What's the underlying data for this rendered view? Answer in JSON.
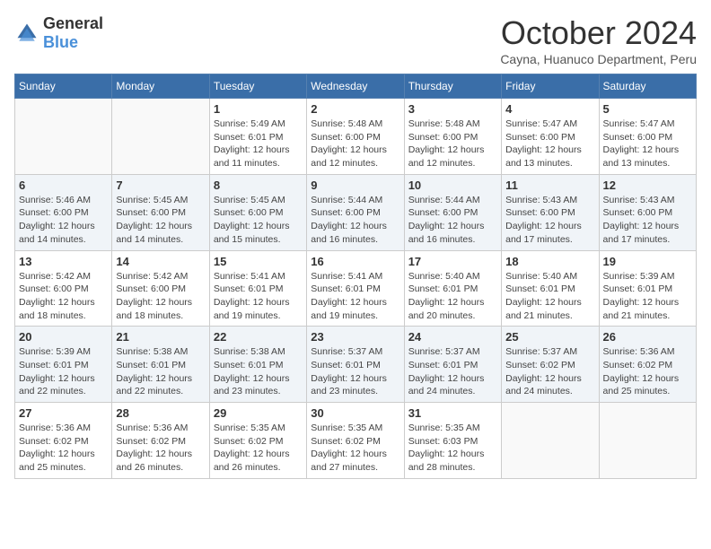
{
  "header": {
    "logo_general": "General",
    "logo_blue": "Blue",
    "month": "October 2024",
    "location": "Cayna, Huanuco Department, Peru"
  },
  "weekdays": [
    "Sunday",
    "Monday",
    "Tuesday",
    "Wednesday",
    "Thursday",
    "Friday",
    "Saturday"
  ],
  "weeks": [
    [
      {
        "day": "",
        "sunrise": "",
        "sunset": "",
        "daylight": ""
      },
      {
        "day": "",
        "sunrise": "",
        "sunset": "",
        "daylight": ""
      },
      {
        "day": "1",
        "sunrise": "Sunrise: 5:49 AM",
        "sunset": "Sunset: 6:01 PM",
        "daylight": "Daylight: 12 hours and 11 minutes."
      },
      {
        "day": "2",
        "sunrise": "Sunrise: 5:48 AM",
        "sunset": "Sunset: 6:00 PM",
        "daylight": "Daylight: 12 hours and 12 minutes."
      },
      {
        "day": "3",
        "sunrise": "Sunrise: 5:48 AM",
        "sunset": "Sunset: 6:00 PM",
        "daylight": "Daylight: 12 hours and 12 minutes."
      },
      {
        "day": "4",
        "sunrise": "Sunrise: 5:47 AM",
        "sunset": "Sunset: 6:00 PM",
        "daylight": "Daylight: 12 hours and 13 minutes."
      },
      {
        "day": "5",
        "sunrise": "Sunrise: 5:47 AM",
        "sunset": "Sunset: 6:00 PM",
        "daylight": "Daylight: 12 hours and 13 minutes."
      }
    ],
    [
      {
        "day": "6",
        "sunrise": "Sunrise: 5:46 AM",
        "sunset": "Sunset: 6:00 PM",
        "daylight": "Daylight: 12 hours and 14 minutes."
      },
      {
        "day": "7",
        "sunrise": "Sunrise: 5:45 AM",
        "sunset": "Sunset: 6:00 PM",
        "daylight": "Daylight: 12 hours and 14 minutes."
      },
      {
        "day": "8",
        "sunrise": "Sunrise: 5:45 AM",
        "sunset": "Sunset: 6:00 PM",
        "daylight": "Daylight: 12 hours and 15 minutes."
      },
      {
        "day": "9",
        "sunrise": "Sunrise: 5:44 AM",
        "sunset": "Sunset: 6:00 PM",
        "daylight": "Daylight: 12 hours and 16 minutes."
      },
      {
        "day": "10",
        "sunrise": "Sunrise: 5:44 AM",
        "sunset": "Sunset: 6:00 PM",
        "daylight": "Daylight: 12 hours and 16 minutes."
      },
      {
        "day": "11",
        "sunrise": "Sunrise: 5:43 AM",
        "sunset": "Sunset: 6:00 PM",
        "daylight": "Daylight: 12 hours and 17 minutes."
      },
      {
        "day": "12",
        "sunrise": "Sunrise: 5:43 AM",
        "sunset": "Sunset: 6:00 PM",
        "daylight": "Daylight: 12 hours and 17 minutes."
      }
    ],
    [
      {
        "day": "13",
        "sunrise": "Sunrise: 5:42 AM",
        "sunset": "Sunset: 6:00 PM",
        "daylight": "Daylight: 12 hours and 18 minutes."
      },
      {
        "day": "14",
        "sunrise": "Sunrise: 5:42 AM",
        "sunset": "Sunset: 6:00 PM",
        "daylight": "Daylight: 12 hours and 18 minutes."
      },
      {
        "day": "15",
        "sunrise": "Sunrise: 5:41 AM",
        "sunset": "Sunset: 6:01 PM",
        "daylight": "Daylight: 12 hours and 19 minutes."
      },
      {
        "day": "16",
        "sunrise": "Sunrise: 5:41 AM",
        "sunset": "Sunset: 6:01 PM",
        "daylight": "Daylight: 12 hours and 19 minutes."
      },
      {
        "day": "17",
        "sunrise": "Sunrise: 5:40 AM",
        "sunset": "Sunset: 6:01 PM",
        "daylight": "Daylight: 12 hours and 20 minutes."
      },
      {
        "day": "18",
        "sunrise": "Sunrise: 5:40 AM",
        "sunset": "Sunset: 6:01 PM",
        "daylight": "Daylight: 12 hours and 21 minutes."
      },
      {
        "day": "19",
        "sunrise": "Sunrise: 5:39 AM",
        "sunset": "Sunset: 6:01 PM",
        "daylight": "Daylight: 12 hours and 21 minutes."
      }
    ],
    [
      {
        "day": "20",
        "sunrise": "Sunrise: 5:39 AM",
        "sunset": "Sunset: 6:01 PM",
        "daylight": "Daylight: 12 hours and 22 minutes."
      },
      {
        "day": "21",
        "sunrise": "Sunrise: 5:38 AM",
        "sunset": "Sunset: 6:01 PM",
        "daylight": "Daylight: 12 hours and 22 minutes."
      },
      {
        "day": "22",
        "sunrise": "Sunrise: 5:38 AM",
        "sunset": "Sunset: 6:01 PM",
        "daylight": "Daylight: 12 hours and 23 minutes."
      },
      {
        "day": "23",
        "sunrise": "Sunrise: 5:37 AM",
        "sunset": "Sunset: 6:01 PM",
        "daylight": "Daylight: 12 hours and 23 minutes."
      },
      {
        "day": "24",
        "sunrise": "Sunrise: 5:37 AM",
        "sunset": "Sunset: 6:01 PM",
        "daylight": "Daylight: 12 hours and 24 minutes."
      },
      {
        "day": "25",
        "sunrise": "Sunrise: 5:37 AM",
        "sunset": "Sunset: 6:02 PM",
        "daylight": "Daylight: 12 hours and 24 minutes."
      },
      {
        "day": "26",
        "sunrise": "Sunrise: 5:36 AM",
        "sunset": "Sunset: 6:02 PM",
        "daylight": "Daylight: 12 hours and 25 minutes."
      }
    ],
    [
      {
        "day": "27",
        "sunrise": "Sunrise: 5:36 AM",
        "sunset": "Sunset: 6:02 PM",
        "daylight": "Daylight: 12 hours and 25 minutes."
      },
      {
        "day": "28",
        "sunrise": "Sunrise: 5:36 AM",
        "sunset": "Sunset: 6:02 PM",
        "daylight": "Daylight: 12 hours and 26 minutes."
      },
      {
        "day": "29",
        "sunrise": "Sunrise: 5:35 AM",
        "sunset": "Sunset: 6:02 PM",
        "daylight": "Daylight: 12 hours and 26 minutes."
      },
      {
        "day": "30",
        "sunrise": "Sunrise: 5:35 AM",
        "sunset": "Sunset: 6:02 PM",
        "daylight": "Daylight: 12 hours and 27 minutes."
      },
      {
        "day": "31",
        "sunrise": "Sunrise: 5:35 AM",
        "sunset": "Sunset: 6:03 PM",
        "daylight": "Daylight: 12 hours and 28 minutes."
      },
      {
        "day": "",
        "sunrise": "",
        "sunset": "",
        "daylight": ""
      },
      {
        "day": "",
        "sunrise": "",
        "sunset": "",
        "daylight": ""
      }
    ]
  ]
}
